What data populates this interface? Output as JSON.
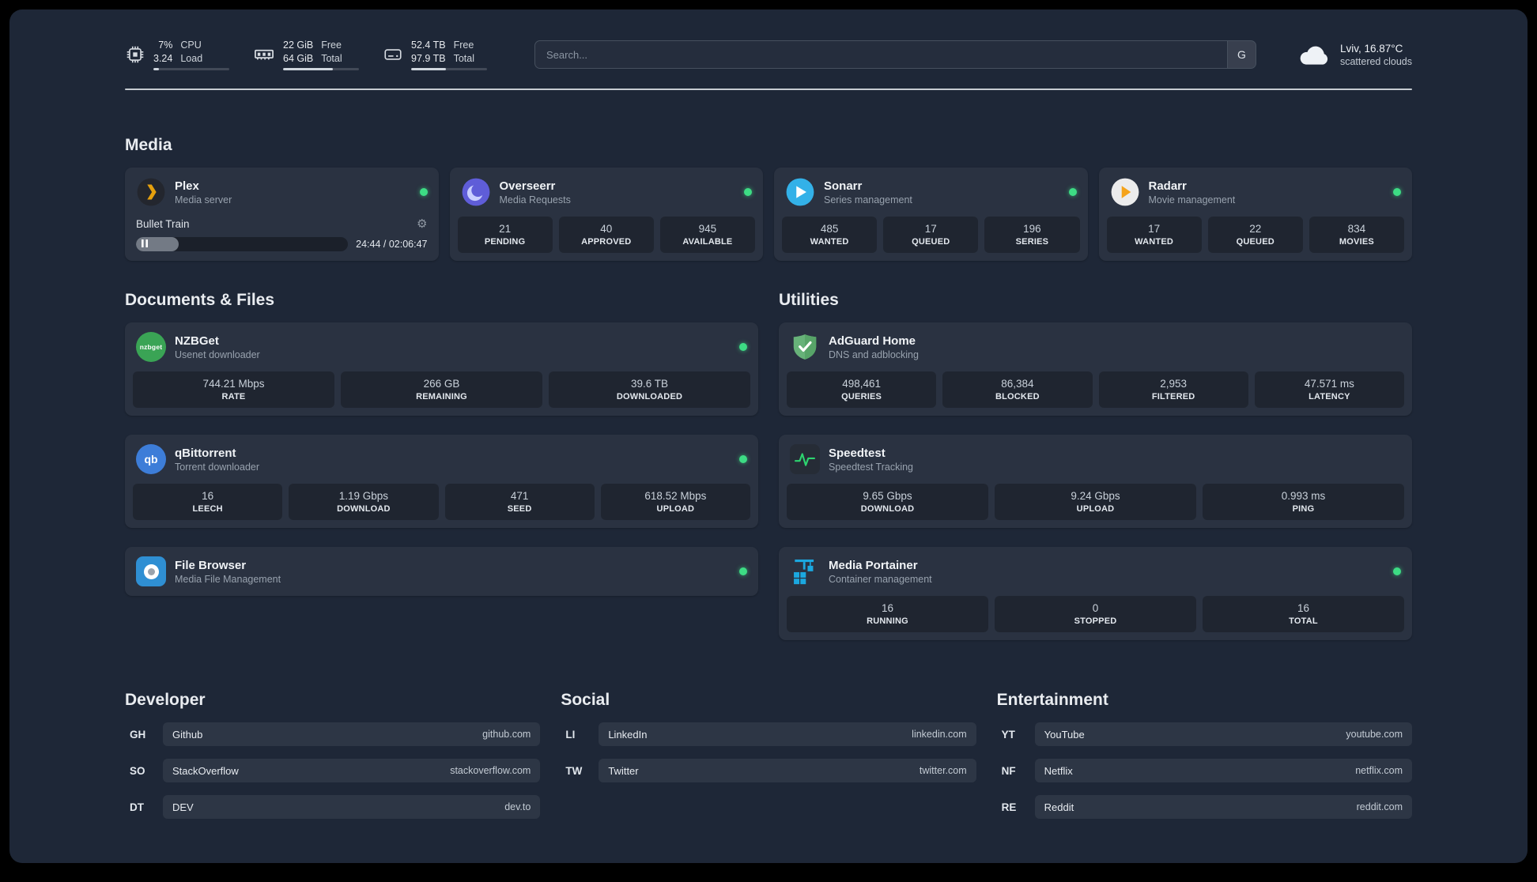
{
  "colors": {
    "status_online": "#3ddc84",
    "accent_green": "#2dd36f",
    "background": "#1e2737"
  },
  "topbar": {
    "cpu": {
      "value_top": "7%",
      "value_bottom": "3.24",
      "label_top": "CPU",
      "label_bottom": "Load",
      "progress": 7
    },
    "memory": {
      "value_top": "22 GiB",
      "value_bottom": "64 GiB",
      "label_top": "Free",
      "label_bottom": "Total",
      "progress": 66
    },
    "disk": {
      "value_top": "52.4 TB",
      "value_bottom": "97.9 TB",
      "label_top": "Free",
      "label_bottom": "Total",
      "progress": 46
    },
    "search": {
      "placeholder": "Search...",
      "button_label": "G"
    },
    "weather": {
      "location": "Lviv, 16.87°C",
      "condition": "scattered clouds"
    }
  },
  "groups": {
    "media": {
      "title": "Media",
      "services": [
        {
          "name": "Plex",
          "desc": "Media server",
          "online": true,
          "player": {
            "track": "Bullet Train",
            "time": "24:44 / 02:06:47",
            "progress": 20
          }
        },
        {
          "name": "Overseerr",
          "desc": "Media Requests",
          "online": true,
          "stats": [
            {
              "value": "21",
              "label": "PENDING"
            },
            {
              "value": "40",
              "label": "APPROVED"
            },
            {
              "value": "945",
              "label": "AVAILABLE"
            }
          ]
        },
        {
          "name": "Sonarr",
          "desc": "Series management",
          "online": true,
          "stats": [
            {
              "value": "485",
              "label": "WANTED"
            },
            {
              "value": "17",
              "label": "QUEUED"
            },
            {
              "value": "196",
              "label": "SERIES"
            }
          ]
        },
        {
          "name": "Radarr",
          "desc": "Movie management",
          "online": true,
          "stats": [
            {
              "value": "17",
              "label": "WANTED"
            },
            {
              "value": "22",
              "label": "QUEUED"
            },
            {
              "value": "834",
              "label": "MOVIES"
            }
          ]
        }
      ]
    },
    "documents": {
      "title": "Documents & Files",
      "services": [
        {
          "name": "NZBGet",
          "desc": "Usenet downloader",
          "online": true,
          "icon_text": "nzbget",
          "stats": [
            {
              "value": "744.21 Mbps",
              "label": "RATE"
            },
            {
              "value": "266 GB",
              "label": "REMAINING"
            },
            {
              "value": "39.6 TB",
              "label": "DOWNLOADED"
            }
          ]
        },
        {
          "name": "qBittorrent",
          "desc": "Torrent downloader",
          "online": true,
          "icon_text": "qb",
          "stats": [
            {
              "value": "16",
              "label": "LEECH"
            },
            {
              "value": "1.19 Gbps",
              "label": "DOWNLOAD"
            },
            {
              "value": "471",
              "label": "SEED"
            },
            {
              "value": "618.52 Mbps",
              "label": "UPLOAD"
            }
          ]
        },
        {
          "name": "File Browser",
          "desc": "Media File Management",
          "online": true
        }
      ]
    },
    "utilities": {
      "title": "Utilities",
      "services": [
        {
          "name": "AdGuard Home",
          "desc": "DNS and adblocking",
          "online": false,
          "stats": [
            {
              "value": "498,461",
              "label": "QUERIES"
            },
            {
              "value": "86,384",
              "label": "BLOCKED"
            },
            {
              "value": "2,953",
              "label": "FILTERED"
            },
            {
              "value": "47.571 ms",
              "label": "LATENCY"
            }
          ]
        },
        {
          "name": "Speedtest",
          "desc": "Speedtest Tracking",
          "online": false,
          "stats": [
            {
              "value": "9.65 Gbps",
              "label": "DOWNLOAD"
            },
            {
              "value": "9.24 Gbps",
              "label": "UPLOAD"
            },
            {
              "value": "0.993 ms",
              "label": "PING"
            }
          ]
        },
        {
          "name": "Media Portainer",
          "desc": "Container management",
          "online": true,
          "stats": [
            {
              "value": "16",
              "label": "RUNNING"
            },
            {
              "value": "0",
              "label": "STOPPED"
            },
            {
              "value": "16",
              "label": "TOTAL"
            }
          ]
        }
      ]
    }
  },
  "bookmarks": [
    {
      "title": "Developer",
      "items": [
        {
          "abbr": "GH",
          "name": "Github",
          "url": "github.com"
        },
        {
          "abbr": "SO",
          "name": "StackOverflow",
          "url": "stackoverflow.com"
        },
        {
          "abbr": "DT",
          "name": "DEV",
          "url": "dev.to"
        }
      ]
    },
    {
      "title": "Social",
      "items": [
        {
          "abbr": "LI",
          "name": "LinkedIn",
          "url": "linkedin.com"
        },
        {
          "abbr": "TW",
          "name": "Twitter",
          "url": "twitter.com"
        }
      ]
    },
    {
      "title": "Entertainment",
      "items": [
        {
          "abbr": "YT",
          "name": "YouTube",
          "url": "youtube.com"
        },
        {
          "abbr": "NF",
          "name": "Netflix",
          "url": "netflix.com"
        },
        {
          "abbr": "RE",
          "name": "Reddit",
          "url": "reddit.com"
        }
      ]
    }
  ]
}
